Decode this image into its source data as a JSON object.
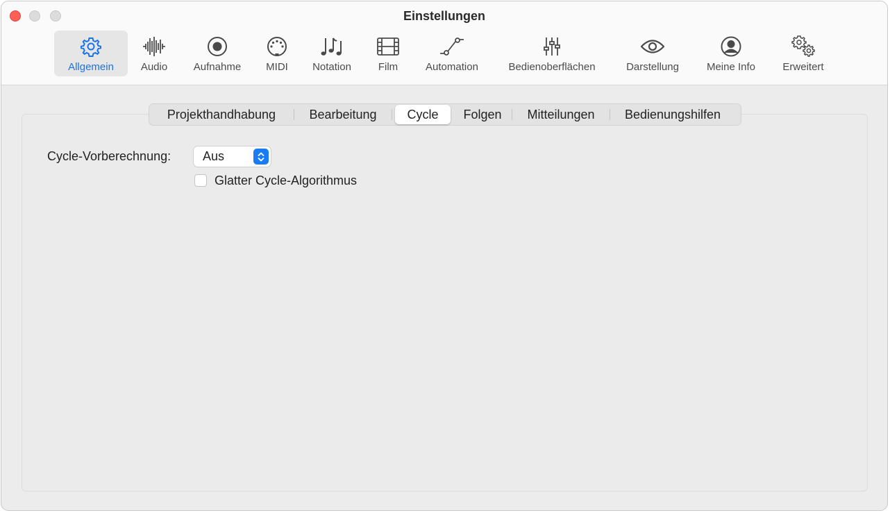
{
  "window": {
    "title": "Einstellungen"
  },
  "toolbar": {
    "items": [
      {
        "label": "Allgemein",
        "icon": "gear-icon",
        "selected": true
      },
      {
        "label": "Audio",
        "icon": "waveform-icon"
      },
      {
        "label": "Aufnahme",
        "icon": "record-icon"
      },
      {
        "label": "MIDI",
        "icon": "midi-port-icon"
      },
      {
        "label": "Notation",
        "icon": "music-notes-icon"
      },
      {
        "label": "Film",
        "icon": "film-icon"
      },
      {
        "label": "Automation",
        "icon": "automation-curve-icon"
      },
      {
        "label": "Bedienoberflächen",
        "icon": "sliders-icon"
      },
      {
        "label": "Darstellung",
        "icon": "eye-icon"
      },
      {
        "label": "Meine Info",
        "icon": "person-circle-icon"
      },
      {
        "label": "Erweitert",
        "icon": "gears-icon"
      }
    ]
  },
  "tabs": [
    {
      "label": "Projekthandhabung"
    },
    {
      "label": "Bearbeitung"
    },
    {
      "label": "Cycle",
      "active": true
    },
    {
      "label": "Folgen"
    },
    {
      "label": "Mitteilungen"
    },
    {
      "label": "Bedienungshilfen"
    }
  ],
  "cycle": {
    "prerender_label": "Cycle-Vorberechnung:",
    "prerender_value": "Aus",
    "smooth_label": "Glatter Cycle-Algorithmus",
    "smooth_checked": false
  },
  "colors": {
    "accent": "#1a73e8",
    "popup_arrow_bg": "#1a7cf5",
    "close": "#fe5f57"
  }
}
